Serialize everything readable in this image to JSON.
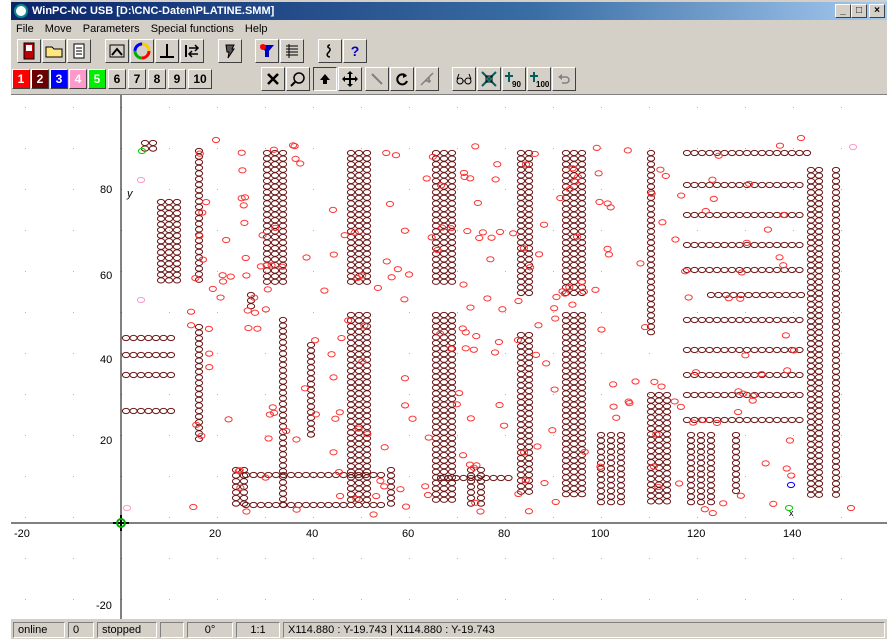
{
  "window": {
    "title": "WinPC-NC USB [D:\\CNC-Daten\\PLATINE.SMM]",
    "minimize": "_",
    "maximize": "□",
    "close": "×"
  },
  "menu": [
    "File",
    "Move",
    "Parameters",
    "Special functions",
    "Help"
  ],
  "toolbar1": {
    "icons": [
      "exit-icon",
      "open-folder-icon",
      "document-icon",
      "view-icon",
      "color-wheel-icon",
      "axis-icon",
      "swap-icon",
      "tool-icon",
      "filter-icon",
      "list-icon",
      "info-icon",
      "help-icon"
    ],
    "help_label": "?"
  },
  "toolbar2": {
    "tools": [
      {
        "label": "1",
        "color": "#ff0000"
      },
      {
        "label": "2",
        "color": "#7a0000"
      },
      {
        "label": "3",
        "color": "#0000ff"
      },
      {
        "label": "4",
        "color": "#ff99cc"
      },
      {
        "label": "5",
        "color": "#00ff00"
      },
      {
        "label": "6",
        "color": ""
      },
      {
        "label": "7",
        "color": ""
      },
      {
        "label": "8",
        "color": ""
      },
      {
        "label": "9",
        "color": ""
      },
      {
        "label": "10",
        "color": ""
      }
    ],
    "view_icons": [
      "cancel-x-icon",
      "zoom-icon",
      "home-arrow-icon",
      "move-cross-icon",
      "tool-probe-icon",
      "redo-rotate-icon",
      "path-icon",
      "glasses-icon",
      "center-icon",
      "rotate-90-icon",
      "rotate-100-icon",
      "undo-icon"
    ],
    "rot90": "90",
    "rot100": "100"
  },
  "plot": {
    "x_ticks": [
      "-20",
      "20",
      "40",
      "60",
      "80",
      "100",
      "120",
      "140"
    ],
    "y_ticks": [
      "80",
      "60",
      "40",
      "20",
      "-20"
    ],
    "y_axis_letter": "y",
    "x_marker": "x",
    "colors": {
      "drill_dark": "#6b1515",
      "drill_red": "#ff3030",
      "pink": "#ff99cc",
      "green": "#00cc00",
      "blue": "#0000ff"
    }
  },
  "status": {
    "connection": "online",
    "counter": "0",
    "state": "stopped",
    "angle": "0°",
    "scale": "1:1",
    "coords": "X114.880 : Y-19.743  |  X114.880 : Y-19.743"
  }
}
